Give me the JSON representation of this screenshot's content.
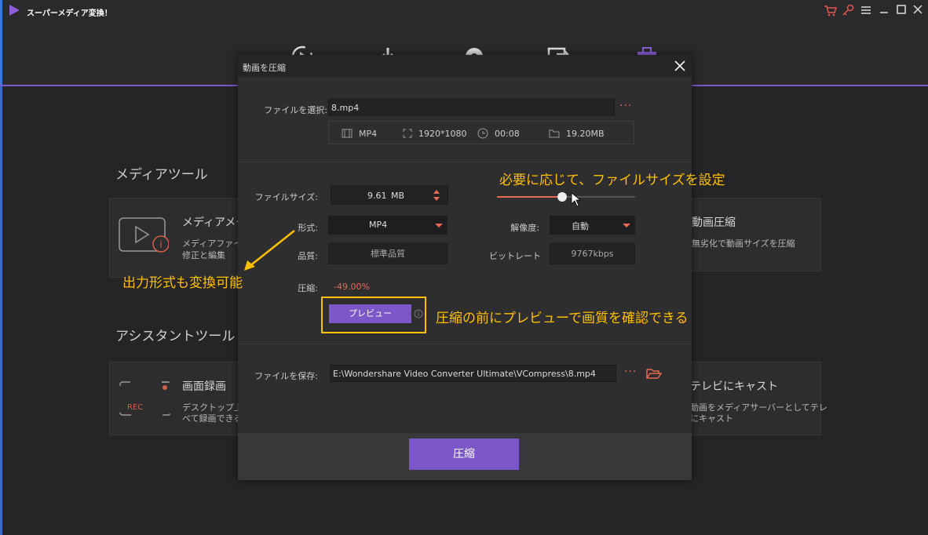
{
  "app": {
    "title": "スーパーメディア変換！"
  },
  "background": {
    "media_section_title": "メディアツール",
    "assistant_section_title": "アシスタントツール",
    "metadata_card": {
      "title": "メディアメタデ",
      "desc_line1": "メディアファイルの",
      "desc_line2": "修正と編集"
    },
    "compress_card": {
      "title": "動画圧縮",
      "desc": "無劣化で動画サイズを圧縮"
    },
    "record_card": {
      "title": "画面録画",
      "desc_line1": "デスクトップ上の",
      "desc_line2": "べて録画できる",
      "rec_label": "REC"
    },
    "cast_card": {
      "title": "テレビにキャスト",
      "desc_line1": "動画をメディアサーバーとしてテレ",
      "desc_line2": "にキャスト"
    }
  },
  "dialog": {
    "title": "動画を圧縮",
    "select_label": "ファイルを選択:",
    "file_name": "8.mp4",
    "more_dots": "···",
    "info": {
      "format": "MP4",
      "resolution": "1920*1080",
      "duration": "00:08",
      "size": "19.20MB"
    },
    "filesize_label": "ファイルサイズ:",
    "filesize_value": "9.61",
    "filesize_unit": "MB",
    "slider_level_fraction": 0.47,
    "format_label": "形式:",
    "format_value": "MP4",
    "resolution_label": "解像度:",
    "resolution_value": "自動",
    "quality_label": "品質:",
    "quality_value": "標準品質",
    "bitrate_label": "ビットレート",
    "bitrate_value": "9767kbps",
    "compression_label": "圧縮:",
    "compression_value": "-49.00%",
    "preview_button": "プレビュー",
    "save_label": "ファイルを保存:",
    "save_path": "E:\\Wondershare Video Converter Ultimate\\VCompress\\8.mp4",
    "compress_button": "圧縮"
  },
  "annotations": {
    "filesize_note": "必要に応じて、ファイルサイズを設定",
    "format_note": "出力形式も変換可能",
    "preview_note": "圧縮の前にプレビューで画質を確認できる"
  },
  "colors": {
    "accent": "#7b57c8",
    "annotation": "#ffc000",
    "warning": "#e86a50"
  }
}
